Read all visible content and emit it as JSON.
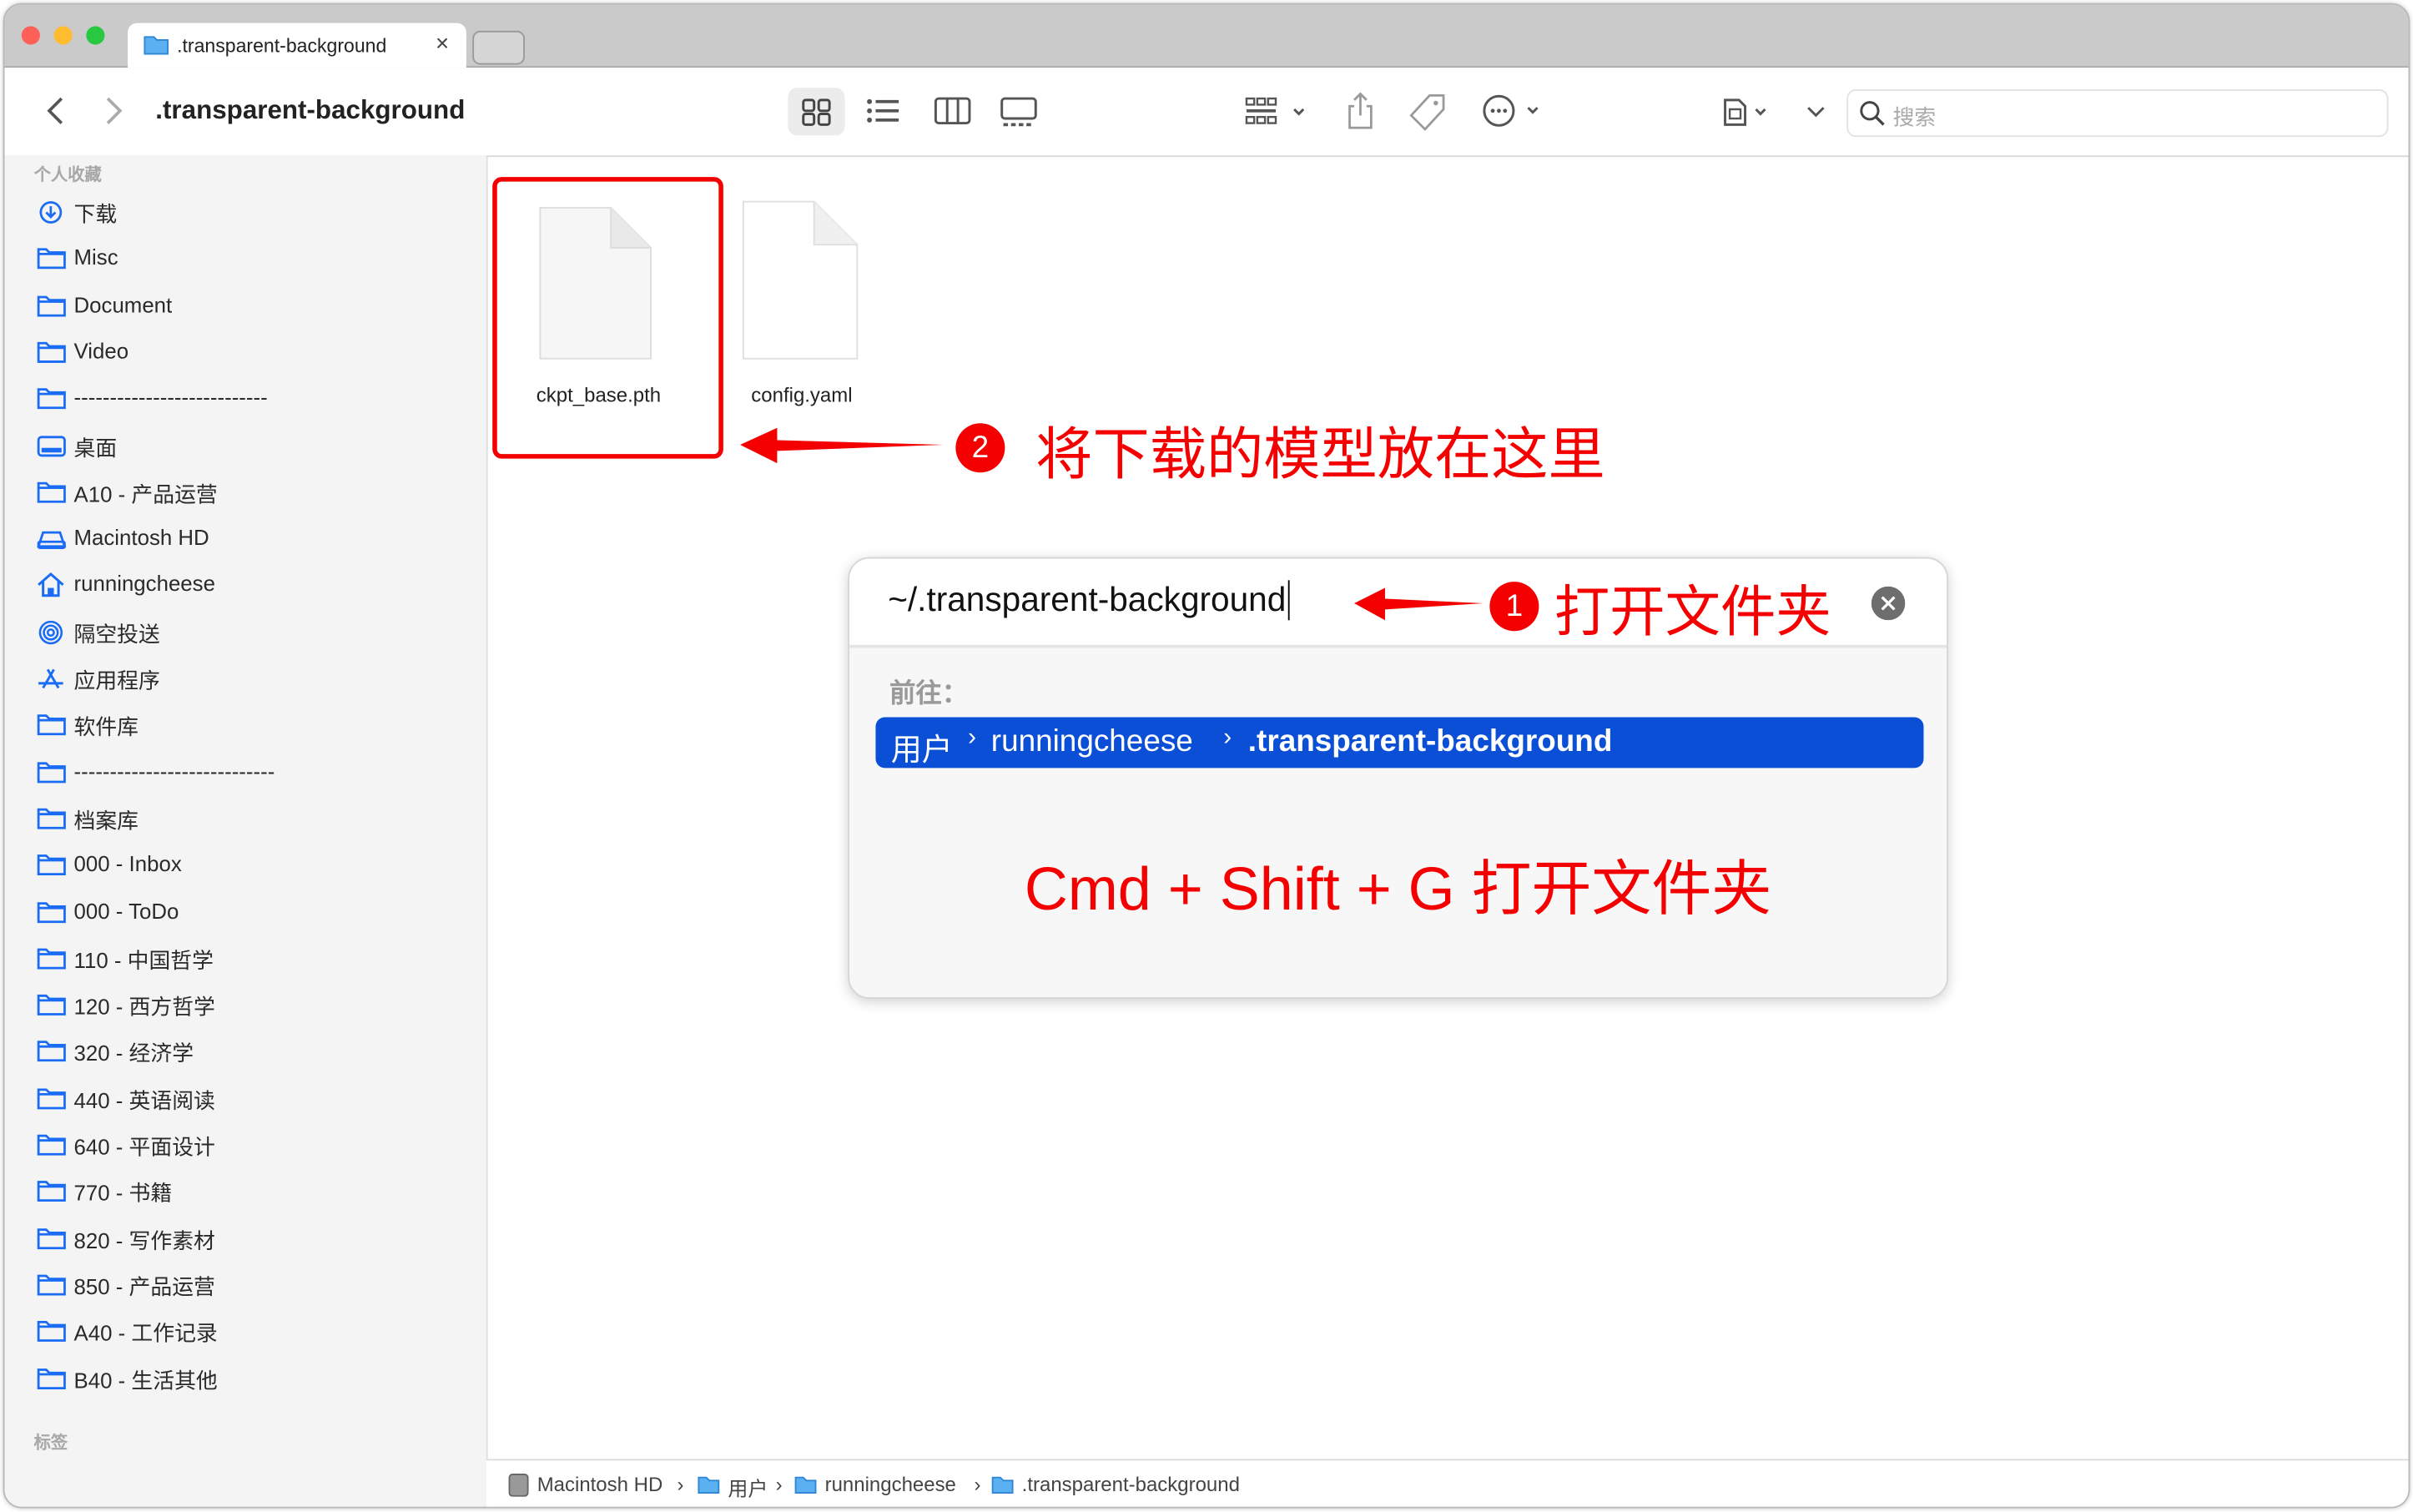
{
  "window": {
    "tab_title": ".transparent-background",
    "tab_close": "×",
    "traffic_lights": [
      "#fe5f57",
      "#febc2e",
      "#28c840"
    ]
  },
  "toolbar": {
    "title": ".transparent-background",
    "search_placeholder": "搜索",
    "icons": [
      "chevron-left-icon",
      "chevron-right-icon",
      "icon-view-icon",
      "list-view-icon",
      "column-view-icon",
      "gallery-view-icon",
      "group-icon",
      "share-icon",
      "tag-icon",
      "more-icon",
      "new-folder-icon",
      "chevron-down-icon",
      "search-icon"
    ]
  },
  "sidebar": {
    "favorites_header": "个人收藏",
    "items": [
      {
        "label": "下载",
        "icon": "download"
      },
      {
        "label": "Misc",
        "icon": "folder"
      },
      {
        "label": "Document",
        "icon": "folder"
      },
      {
        "label": "Video",
        "icon": "folder"
      },
      {
        "label": "---------------------------",
        "icon": "folder"
      },
      {
        "label": "桌面",
        "icon": "desktop"
      },
      {
        "label": "A10 - 产品运营",
        "icon": "folder"
      },
      {
        "label": "Macintosh HD",
        "icon": "disk"
      },
      {
        "label": "runningcheese",
        "icon": "home"
      },
      {
        "label": "隔空投送",
        "icon": "airdrop"
      },
      {
        "label": "应用程序",
        "icon": "apps"
      },
      {
        "label": "软件库",
        "icon": "folder"
      },
      {
        "label": "----------------------------",
        "icon": "folder"
      },
      {
        "label": "档案库",
        "icon": "folder"
      },
      {
        "label": "000 - Inbox",
        "icon": "folder"
      },
      {
        "label": "000 - ToDo",
        "icon": "folder"
      },
      {
        "label": "110 - 中国哲学",
        "icon": "folder"
      },
      {
        "label": "120 - 西方哲学",
        "icon": "folder"
      },
      {
        "label": "320 - 经济学",
        "icon": "folder"
      },
      {
        "label": "440 - 英语阅读",
        "icon": "folder"
      },
      {
        "label": "640 - 平面设计",
        "icon": "folder"
      },
      {
        "label": "770 - 书籍",
        "icon": "folder"
      },
      {
        "label": "820 - 写作素材",
        "icon": "folder"
      },
      {
        "label": "850 - 产品运营",
        "icon": "folder"
      },
      {
        "label": "A40 - 工作记录",
        "icon": "folder"
      },
      {
        "label": "B40 - 生活其他",
        "icon": "folder"
      }
    ],
    "tags_header": "标签",
    "accent": "#1a6cf5"
  },
  "files": [
    {
      "name": "ckpt_base.pth"
    },
    {
      "name": "config.yaml"
    }
  ],
  "annotations": {
    "step2_num": "2",
    "step2_text": "将下载的模型放在这里",
    "step1_num": "1",
    "step1_text": "打开文件夹",
    "shortcut_text": "Cmd + Shift + G 打开文件夹",
    "color": "#f40000"
  },
  "goto_dialog": {
    "input_value": "~/.transparent-background",
    "goto_label": "前往：",
    "suggestion": [
      "用户",
      "runningcheese",
      ".transparent-background"
    ],
    "highlight": "#0a4fd6"
  },
  "pathbar": [
    "Macintosh HD",
    "用户",
    "runningcheese",
    ".transparent-background"
  ]
}
